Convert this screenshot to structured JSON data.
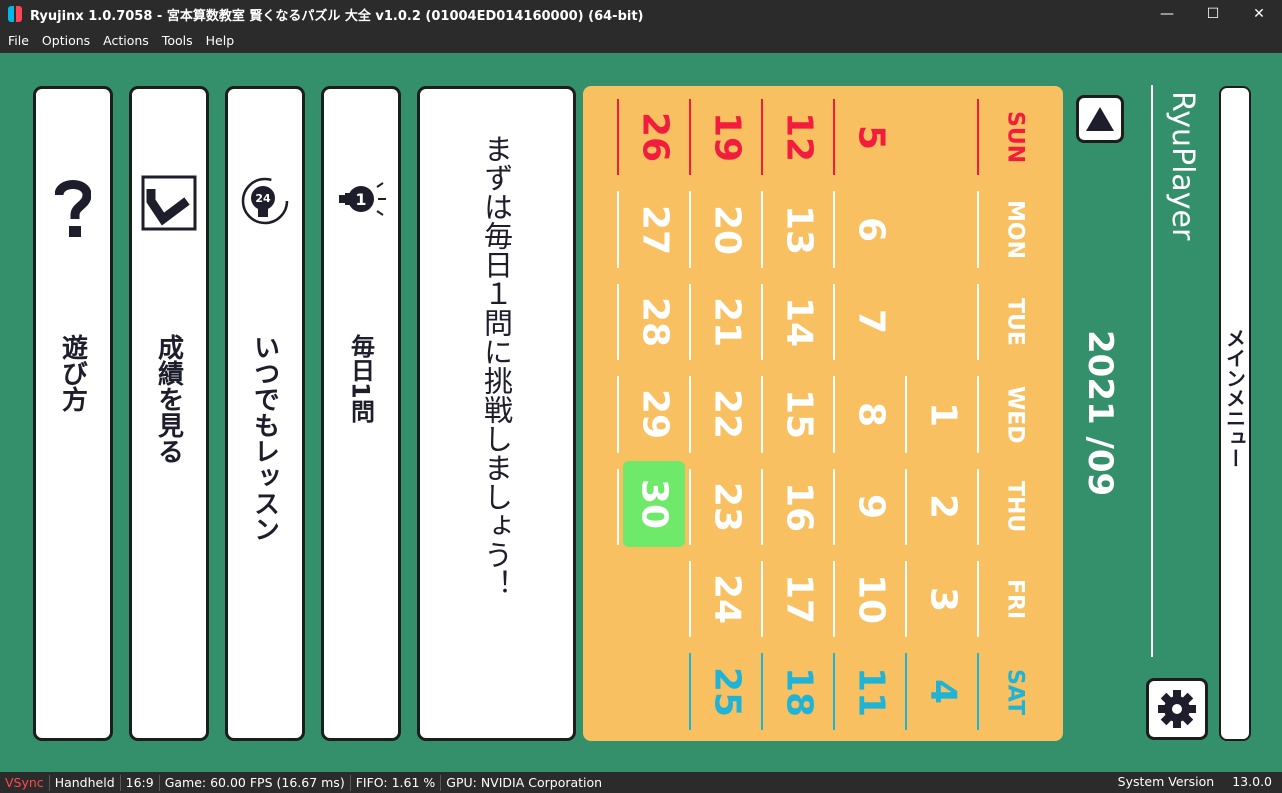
{
  "window": {
    "title": "Ryujinx 1.0.7058 - 宮本算数教室 賢くなるパズル 大全 v1.0.2 (01004ED014160000) (64-bit)",
    "min_glyph": "—",
    "max_glyph": "☐",
    "close_glyph": "✕"
  },
  "menu": {
    "items": [
      "File",
      "Options",
      "Actions",
      "Tools",
      "Help"
    ]
  },
  "game": {
    "buttons": {
      "how_to_play": "遊び方",
      "view_results": "成績を見る",
      "anytime_lesson": "いつでもレッスン",
      "daily_one": "毎日1問"
    },
    "icon_24": "24",
    "icon_1": "1",
    "daily_message": "まずは毎日１問に挑戦しましょう！",
    "calendar": {
      "weekdays": [
        "SUN",
        "MON",
        "TUE",
        "WED",
        "THU",
        "FRI",
        "SAT"
      ],
      "weeks": [
        [
          "",
          "",
          "",
          "1",
          "2",
          "3",
          "4"
        ],
        [
          "5",
          "6",
          "7",
          "8",
          "9",
          "10",
          "11"
        ],
        [
          "12",
          "13",
          "14",
          "15",
          "16",
          "17",
          "18"
        ],
        [
          "19",
          "20",
          "21",
          "22",
          "23",
          "24",
          "25"
        ],
        [
          "26",
          "27",
          "28",
          "29",
          "30",
          "",
          ""
        ]
      ],
      "today": "30",
      "colors": {
        "sunday": "#f21d3e",
        "saturday": "#1fb4d6",
        "today_bg": "#6ee96a",
        "panel": "#f8c060"
      }
    },
    "month_label": "2021 /09",
    "player_name": "RyuPlayer",
    "main_menu": "メインメニュー",
    "up_icon": "triangle-up-icon",
    "settings_icon": "gear-icon"
  },
  "status": {
    "vsync": "VSync",
    "mode": "Handheld",
    "aspect": "16:9",
    "game_fps": "Game: 60.00 FPS (16.67 ms)",
    "fifo": "FIFO: 1.61 %",
    "gpu": "GPU: NVIDIA Corporation",
    "system_version_label": "System Version",
    "system_version": "13.0.0"
  }
}
